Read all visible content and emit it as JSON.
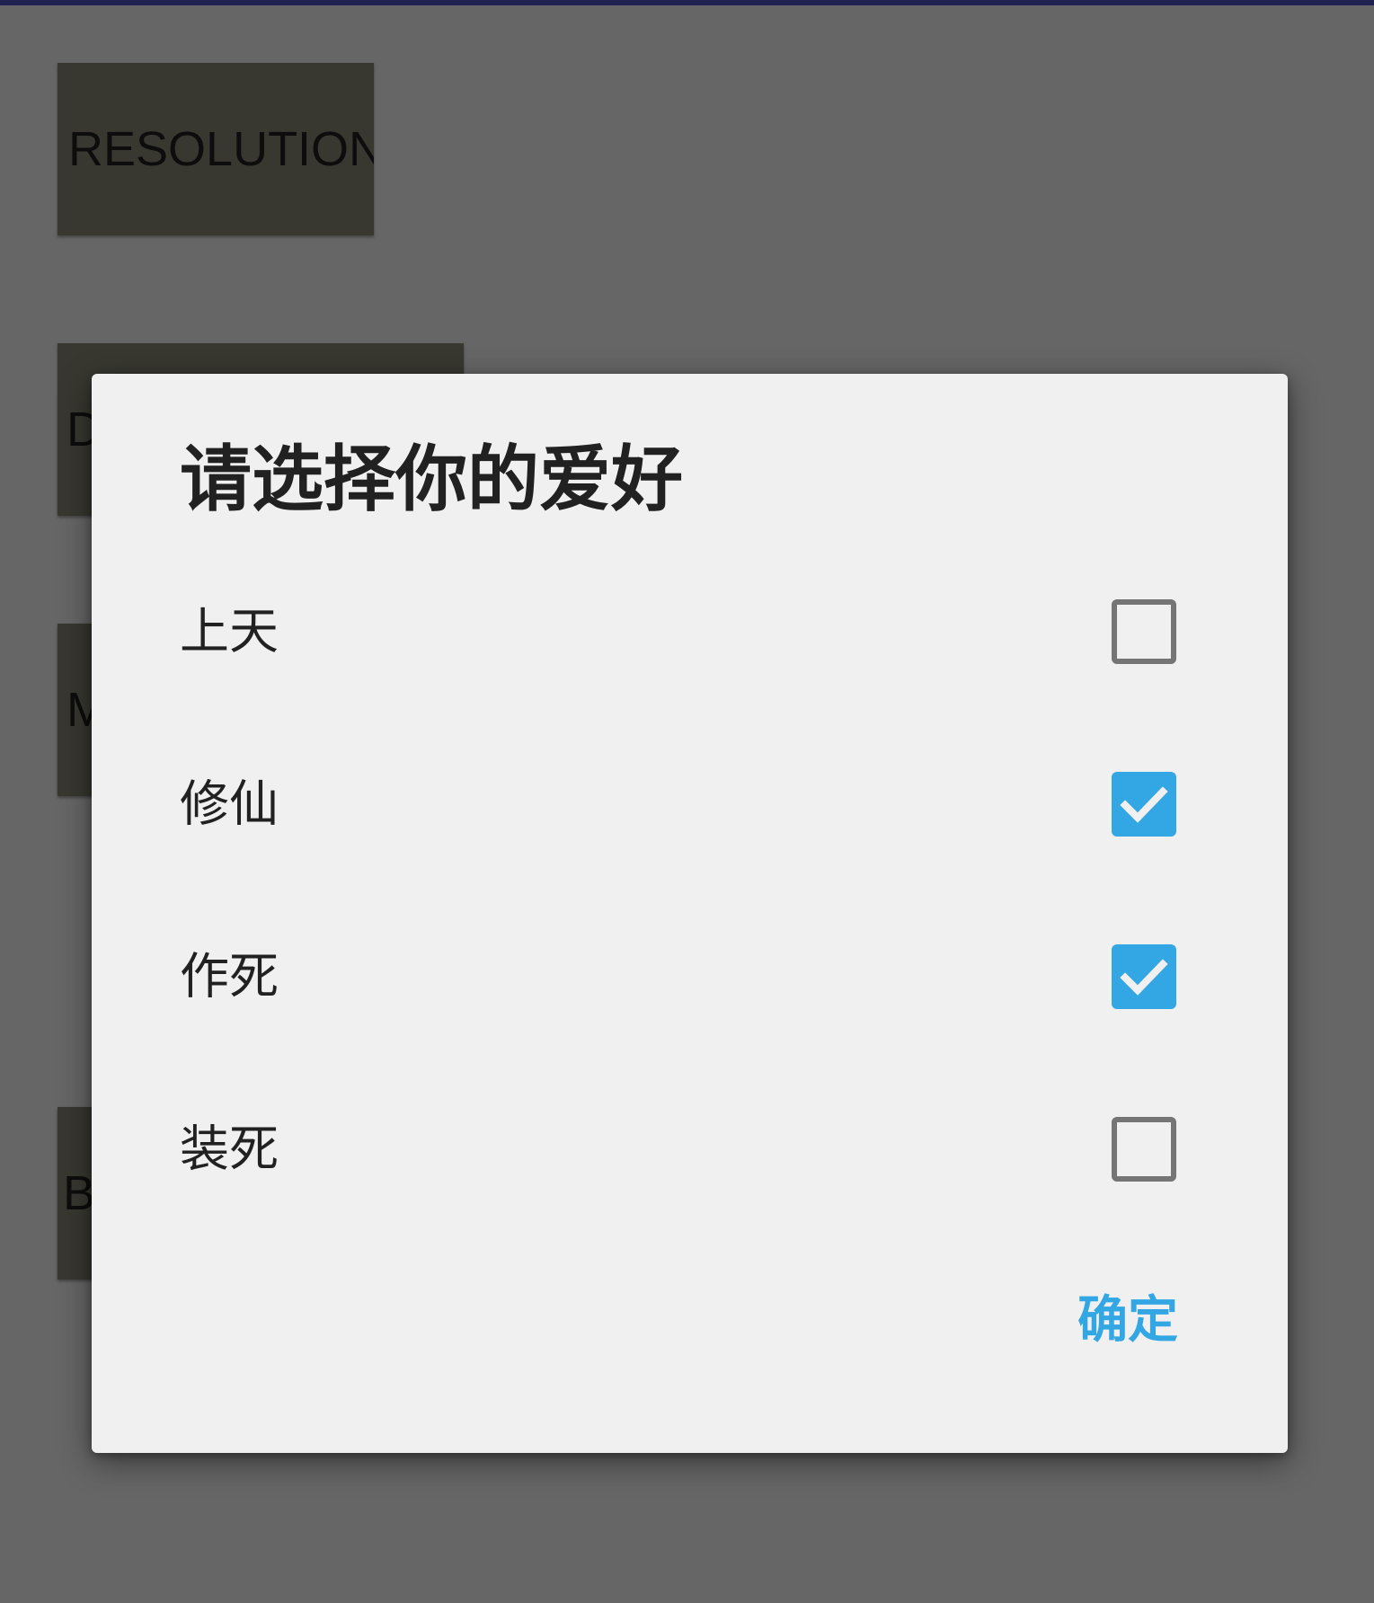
{
  "background": {
    "buttons": [
      {
        "label": "RESOLUTION"
      },
      {
        "label": "D"
      },
      {
        "label": "M"
      },
      {
        "label": "B"
      }
    ]
  },
  "dialog": {
    "title": "请选择你的爱好",
    "options": [
      {
        "label": "上天",
        "checked": false
      },
      {
        "label": "修仙",
        "checked": true
      },
      {
        "label": "作死",
        "checked": true
      },
      {
        "label": "装死",
        "checked": false
      }
    ],
    "confirm_label": "确定"
  },
  "colors": {
    "accent": "#33a6e4",
    "dialog_background": "#f0f0f0",
    "scrim": "#666666",
    "status_bar": "#1f2250",
    "checkbox_border": "#757575"
  }
}
